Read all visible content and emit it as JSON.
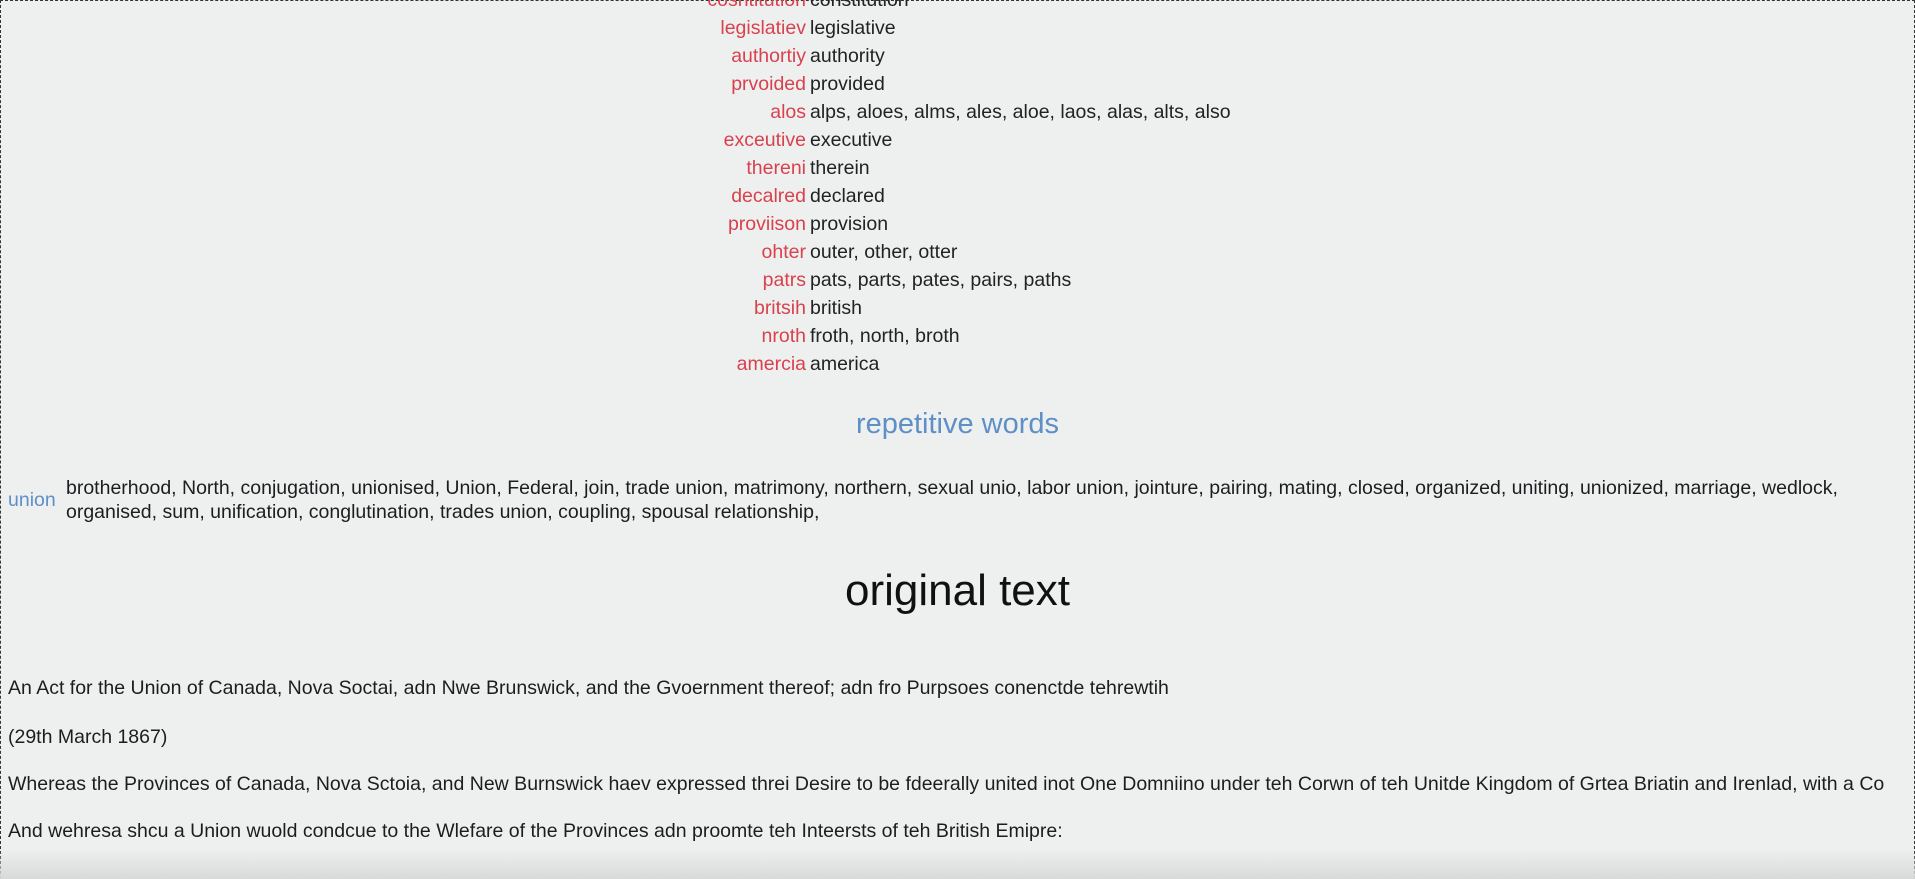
{
  "corrections": [
    {
      "wrong": "cosntitution",
      "right": "constitution"
    },
    {
      "wrong": "legislatiev",
      "right": "legislative"
    },
    {
      "wrong": "authortiy",
      "right": "authority"
    },
    {
      "wrong": "prvoided",
      "right": "provided"
    },
    {
      "wrong": "alos",
      "right": "alps, aloes, alms, ales, aloe, laos, alas, alts, also"
    },
    {
      "wrong": "exceutive",
      "right": "executive"
    },
    {
      "wrong": "thereni",
      "right": "therein"
    },
    {
      "wrong": "decalred",
      "right": "declared"
    },
    {
      "wrong": "proviison",
      "right": "provision"
    },
    {
      "wrong": "ohter",
      "right": "outer, other, otter"
    },
    {
      "wrong": "patrs",
      "right": "pats, parts, pates, pairs, paths"
    },
    {
      "wrong": "britsih",
      "right": "british"
    },
    {
      "wrong": "nroth",
      "right": "froth, north, broth"
    },
    {
      "wrong": "amercia",
      "right": "america"
    }
  ],
  "repetitive": {
    "title": "repetitive words",
    "word": "union",
    "synonyms": "brotherhood, North, conjugation, unionised, Union, Federal, join, trade union, matrimony, northern, sexual unio, labor union, jointure, pairing, mating, closed, organized, uniting, unionized, marriage, wedlock, organised, sum, unification, conglutination, trades union, coupling, spousal relationship,"
  },
  "original": {
    "title": "original text",
    "paragraphs": [
      "An Act for the Union of Canada, Nova Soctai, adn Nwe Brunswick, and the Gvoernment thereof; adn fro Purpsoes conenctde tehrewtih",
      "(29th March 1867)",
      "Whereas the Provinces of Canada, Nova Sctoia, and New Burnswick haev expressed threi Desire to be fdeerally united inot One Domniino under teh Corwn of teh Unitde Kingdom of Grtea Briatin and Irenlad, with a Co",
      "And wehresa shcu a Union wuold condcue to the Wlefare of the Provinces adn proomte teh Inteersts of teh British Emipre:"
    ]
  }
}
